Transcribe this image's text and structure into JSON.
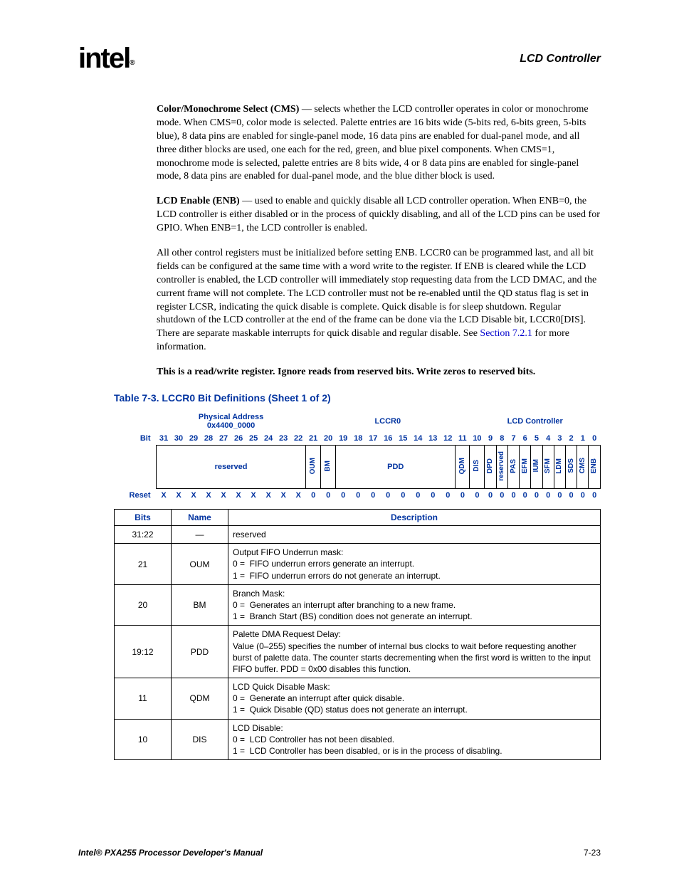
{
  "header": {
    "logo": "intel",
    "logo_r": "®",
    "section": "LCD Controller"
  },
  "paragraphs": {
    "p1": "Color/Monochrome Select (CMS) — selects whether the LCD controller operates in color or monochrome mode. When CMS=0, color mode is selected. Palette entries are 16 bits wide (5-bits red, 6-bits green, 5-bits blue), 8 data pins are enabled for single-panel mode, 16 data pins are enabled for dual-panel mode, and all three dither blocks are used, one each for the red, green, and blue pixel components. When CMS=1, monochrome mode is selected, palette entries are 8 bits wide, 4 or 8 data pins are enabled for single-panel mode, 8 data pins are enabled for dual-panel mode, and the blue dither block is used.",
    "p1_bold": "Color/Monochrome Select (CMS)",
    "p2": "LCD Enable (ENB) — used to enable and quickly disable all LCD controller operation. When ENB=0, the LCD controller is either disabled or in the process of quickly disabling, and all of the LCD pins can be used for GPIO. When ENB=1, the LCD controller is enabled.",
    "p2_bold": "LCD Enable (ENB)",
    "p3a": "All other control registers must be initialized before setting ENB. LCCR0 can be programmed last, and all bit fields can be configured at the same time with a word write to the register. If ENB is cleared while the LCD controller is enabled, the LCD controller will immediately stop requesting data from the LCD DMAC, and the current frame will not complete. The LCD controller must not be re-enabled until the QD status flag is set in register LCSR, indicating the quick disable is complete. Quick disable is for sleep shutdown. Regular shutdown of the LCD controller at the end of the frame can be done via the LCD Disable bit, LCCR0[DIS]. There are separate maskable interrupts for quick disable and regular disable. See ",
    "p3_link": "Section 7.2.1",
    "p3b": " for more information.",
    "p4": "This is a read/write register. Ignore reads from reserved bits. Write zeros to reserved bits."
  },
  "table_caption": "Table 7-3. LCCR0 Bit Definitions (Sheet 1 of 2)",
  "bit_table": {
    "phys_addr_label": "Physical Address",
    "phys_addr_value": "0x4400_0000",
    "reg_name": "LCCR0",
    "module": "LCD Controller",
    "bit_label": "Bit",
    "reset_label": "Reset",
    "bits": [
      "31",
      "30",
      "29",
      "28",
      "27",
      "26",
      "25",
      "24",
      "23",
      "22",
      "21",
      "20",
      "19",
      "18",
      "17",
      "16",
      "15",
      "14",
      "13",
      "12",
      "11",
      "10",
      "9",
      "8",
      "7",
      "6",
      "5",
      "4",
      "3",
      "2",
      "1",
      "0"
    ],
    "fields": {
      "reserved": "reserved",
      "oum": "OUM",
      "bm": "BM",
      "pdd": "PDD",
      "qdm": "QDM",
      "dis": "DIS",
      "dpd": "DPD",
      "res2": "reserved",
      "pas": "PAS",
      "efm": "EFM",
      "ium": "IUM",
      "sfm": "SFM",
      "ldm": "LDM",
      "sds": "SDS",
      "cms": "CMS",
      "enb": "ENB"
    },
    "reset": [
      "X",
      "X",
      "X",
      "X",
      "X",
      "X",
      "X",
      "X",
      "X",
      "X",
      "0",
      "0",
      "0",
      "0",
      "0",
      "0",
      "0",
      "0",
      "0",
      "0",
      "0",
      "0",
      "0",
      "0",
      "0",
      "0",
      "0",
      "0",
      "0",
      "0",
      "0",
      "0"
    ]
  },
  "desc_table": {
    "headers": {
      "bits": "Bits",
      "name": "Name",
      "desc": "Description"
    },
    "rows": [
      {
        "bits": "31:22",
        "name": "—",
        "desc": "reserved"
      },
      {
        "bits": "21",
        "name": "OUM",
        "desc": "Output FIFO Underrun mask:\n0 = FIFO underrun errors generate an interrupt.\n1 = FIFO underrun errors do not generate an interrupt."
      },
      {
        "bits": "20",
        "name": "BM",
        "desc": "Branch Mask:\n0 = Generates an interrupt after branching to a new frame.\n1 = Branch Start (BS) condition does not generate an interrupt."
      },
      {
        "bits": "19:12",
        "name": "PDD",
        "desc": "Palette DMA Request Delay:\nValue (0–255) specifies the number of internal bus clocks to wait before requesting another burst of palette data. The counter starts decrementing when the first word is written to the input FIFO buffer. PDD = 0x00 disables this function."
      },
      {
        "bits": "11",
        "name": "QDM",
        "desc": "LCD Quick Disable Mask:\n0 = Generate an interrupt after quick disable.\n1 = Quick Disable (QD) status does not generate an interrupt."
      },
      {
        "bits": "10",
        "name": "DIS",
        "desc": "LCD Disable:\n0 = LCD Controller has not been disabled.\n1 = LCD Controller has been disabled, or is in the process of disabling."
      }
    ]
  },
  "chart_data": {
    "type": "table",
    "register": "LCCR0",
    "physical_address": "0x4400_0000",
    "module": "LCD Controller",
    "bit_fields": [
      {
        "bits": "31:22",
        "name": "reserved",
        "reset": "X"
      },
      {
        "bits": "21",
        "name": "OUM",
        "reset": "0"
      },
      {
        "bits": "20",
        "name": "BM",
        "reset": "0"
      },
      {
        "bits": "19:12",
        "name": "PDD",
        "reset": "0"
      },
      {
        "bits": "11",
        "name": "QDM",
        "reset": "0"
      },
      {
        "bits": "10",
        "name": "DIS",
        "reset": "0"
      },
      {
        "bits": "9",
        "name": "DPD",
        "reset": "0"
      },
      {
        "bits": "8",
        "name": "reserved",
        "reset": "0"
      },
      {
        "bits": "7",
        "name": "PAS",
        "reset": "0"
      },
      {
        "bits": "6",
        "name": "EFM",
        "reset": "0"
      },
      {
        "bits": "5",
        "name": "IUM",
        "reset": "0"
      },
      {
        "bits": "4",
        "name": "SFM",
        "reset": "0"
      },
      {
        "bits": "3",
        "name": "LDM",
        "reset": "0"
      },
      {
        "bits": "2",
        "name": "SDS",
        "reset": "0"
      },
      {
        "bits": "1",
        "name": "CMS",
        "reset": "0"
      },
      {
        "bits": "0",
        "name": "ENB",
        "reset": "0"
      }
    ]
  },
  "footer": {
    "title": "Intel® PXA255 Processor Developer's Manual",
    "page": "7-23"
  }
}
